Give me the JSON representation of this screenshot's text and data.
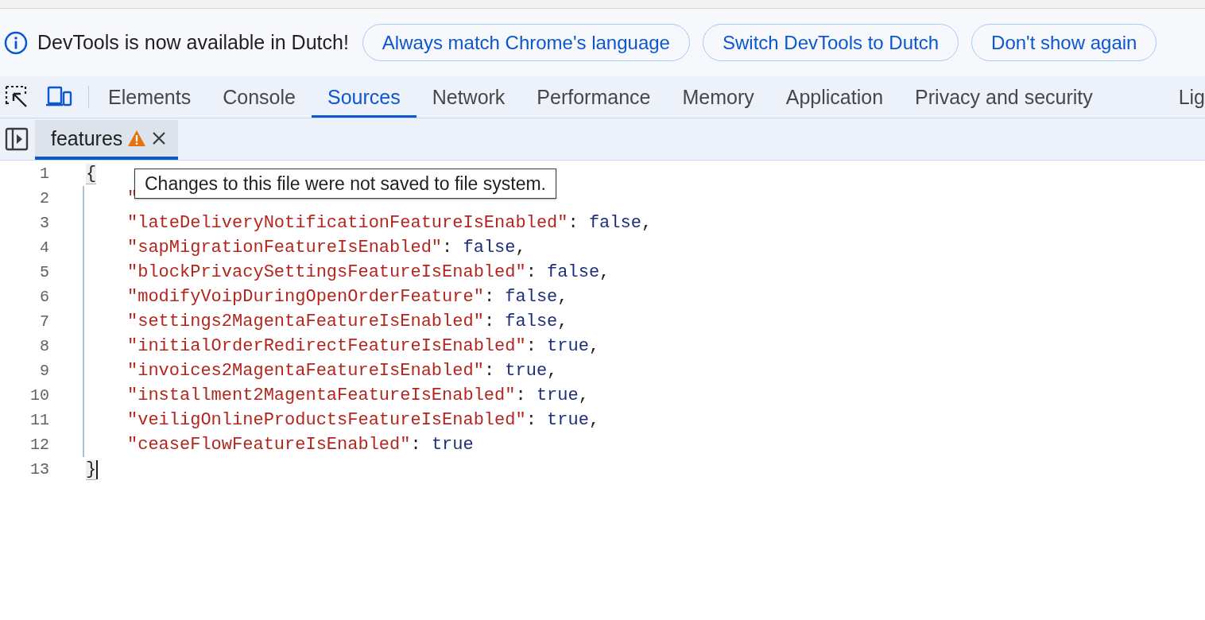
{
  "infobar": {
    "message": "DevTools is now available in Dutch!",
    "buttons": [
      "Always match Chrome's language",
      "Switch DevTools to Dutch",
      "Don't show again"
    ]
  },
  "panel_tabs": [
    {
      "label": "Elements",
      "selected": false
    },
    {
      "label": "Console",
      "selected": false
    },
    {
      "label": "Sources",
      "selected": true
    },
    {
      "label": "Network",
      "selected": false
    },
    {
      "label": "Performance",
      "selected": false
    },
    {
      "label": "Memory",
      "selected": false
    },
    {
      "label": "Application",
      "selected": false
    },
    {
      "label": "Privacy and security",
      "selected": false
    },
    {
      "label": "Lig",
      "selected": false
    }
  ],
  "file_tabs": [
    {
      "label": "features",
      "selected": true,
      "warning": true
    }
  ],
  "tooltip": "Changes to this file were not saved to file system.",
  "code": {
    "lines": [
      {
        "number": "1",
        "indented": false,
        "caret": false,
        "tokens": [
          {
            "kind": "bracket",
            "text": "{"
          }
        ]
      },
      {
        "number": "2",
        "indented": true,
        "caret": false,
        "tokens": [
          {
            "kind": "string",
            "text": "\""
          }
        ]
      },
      {
        "number": "3",
        "indented": true,
        "caret": false,
        "tokens": [
          {
            "kind": "string",
            "text": "\"lateDeliveryNotificationFeatureIsEnabled\""
          },
          {
            "kind": "punct",
            "text": ": "
          },
          {
            "kind": "keyword",
            "text": "false"
          },
          {
            "kind": "punct",
            "text": ","
          }
        ]
      },
      {
        "number": "4",
        "indented": true,
        "caret": false,
        "tokens": [
          {
            "kind": "string",
            "text": "\"sapMigrationFeatureIsEnabled\""
          },
          {
            "kind": "punct",
            "text": ": "
          },
          {
            "kind": "keyword",
            "text": "false"
          },
          {
            "kind": "punct",
            "text": ","
          }
        ]
      },
      {
        "number": "5",
        "indented": true,
        "caret": false,
        "tokens": [
          {
            "kind": "string",
            "text": "\"blockPrivacySettingsFeatureIsEnabled\""
          },
          {
            "kind": "punct",
            "text": ": "
          },
          {
            "kind": "keyword",
            "text": "false"
          },
          {
            "kind": "punct",
            "text": ","
          }
        ]
      },
      {
        "number": "6",
        "indented": true,
        "caret": false,
        "tokens": [
          {
            "kind": "string",
            "text": "\"modifyVoipDuringOpenOrderFeature\""
          },
          {
            "kind": "punct",
            "text": ": "
          },
          {
            "kind": "keyword",
            "text": "false"
          },
          {
            "kind": "punct",
            "text": ","
          }
        ]
      },
      {
        "number": "7",
        "indented": true,
        "caret": false,
        "tokens": [
          {
            "kind": "string",
            "text": "\"settings2MagentaFeatureIsEnabled\""
          },
          {
            "kind": "punct",
            "text": ": "
          },
          {
            "kind": "keyword",
            "text": "false"
          },
          {
            "kind": "punct",
            "text": ","
          }
        ]
      },
      {
        "number": "8",
        "indented": true,
        "caret": false,
        "tokens": [
          {
            "kind": "string",
            "text": "\"initialOrderRedirectFeatureIsEnabled\""
          },
          {
            "kind": "punct",
            "text": ": "
          },
          {
            "kind": "keyword",
            "text": "true"
          },
          {
            "kind": "punct",
            "text": ","
          }
        ]
      },
      {
        "number": "9",
        "indented": true,
        "caret": false,
        "tokens": [
          {
            "kind": "string",
            "text": "\"invoices2MagentaFeatureIsEnabled\""
          },
          {
            "kind": "punct",
            "text": ": "
          },
          {
            "kind": "keyword",
            "text": "true"
          },
          {
            "kind": "punct",
            "text": ","
          }
        ]
      },
      {
        "number": "10",
        "indented": true,
        "caret": false,
        "tokens": [
          {
            "kind": "string",
            "text": "\"installment2MagentaFeatureIsEnabled\""
          },
          {
            "kind": "punct",
            "text": ": "
          },
          {
            "kind": "keyword",
            "text": "true"
          },
          {
            "kind": "punct",
            "text": ","
          }
        ]
      },
      {
        "number": "11",
        "indented": true,
        "caret": false,
        "tokens": [
          {
            "kind": "string",
            "text": "\"veiligOnlineProductsFeatureIsEnabled\""
          },
          {
            "kind": "punct",
            "text": ": "
          },
          {
            "kind": "keyword",
            "text": "true"
          },
          {
            "kind": "punct",
            "text": ","
          }
        ]
      },
      {
        "number": "12",
        "indented": true,
        "caret": false,
        "tokens": [
          {
            "kind": "string",
            "text": "\"ceaseFlowFeatureIsEnabled\""
          },
          {
            "kind": "punct",
            "text": ": "
          },
          {
            "kind": "keyword",
            "text": "true"
          }
        ]
      },
      {
        "number": "13",
        "indented": false,
        "caret": true,
        "tokens": [
          {
            "kind": "bracket",
            "text": "}"
          }
        ]
      }
    ]
  }
}
